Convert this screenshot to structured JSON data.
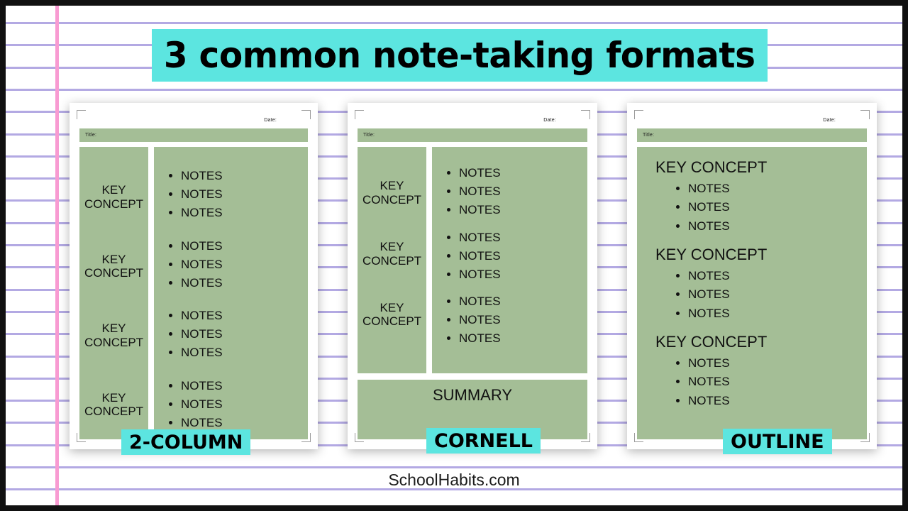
{
  "title": {
    "text": "3 common note-taking formats",
    "highlight_color": "#5ce5e0"
  },
  "footer": {
    "text": "SchoolHabits.com"
  },
  "theme": {
    "green": "#a4be96",
    "cyan": "#5ce5e0",
    "rule_line": "#b3a9e3",
    "margin_line": "#f89bd2",
    "page_border": "#111111"
  },
  "sheet_labels": {
    "date": "Date:",
    "title": "Title:"
  },
  "cards": [
    {
      "id": "2column",
      "badge": "2-COLUMN",
      "date_label": "Date:",
      "title_label": "Title:",
      "key_concepts": [
        "KEY CONCEPT",
        "KEY CONCEPT",
        "KEY CONCEPT",
        "KEY CONCEPT"
      ],
      "note_groups": [
        [
          "NOTES",
          "NOTES",
          "NOTES"
        ],
        [
          "NOTES",
          "NOTES",
          "NOTES"
        ],
        [
          "NOTES",
          "NOTES",
          "NOTES"
        ],
        [
          "NOTES",
          "NOTES",
          "NOTES"
        ]
      ]
    },
    {
      "id": "cornell",
      "badge": "CORNELL",
      "date_label": "Date:",
      "title_label": "Title:",
      "key_concepts": [
        "KEY CONCEPT",
        "KEY CONCEPT",
        "KEY CONCEPT"
      ],
      "note_groups": [
        [
          "NOTES",
          "NOTES",
          "NOTES"
        ],
        [
          "NOTES",
          "NOTES",
          "NOTES"
        ],
        [
          "NOTES",
          "NOTES",
          "NOTES"
        ]
      ],
      "summary_label": "SUMMARY"
    },
    {
      "id": "outline",
      "badge": "OUTLINE",
      "date_label": "Date:",
      "title_label": "Title:",
      "outline_groups": [
        {
          "heading": "KEY CONCEPT",
          "notes": [
            "NOTES",
            "NOTES",
            "NOTES"
          ]
        },
        {
          "heading": "KEY CONCEPT",
          "notes": [
            "NOTES",
            "NOTES",
            "NOTES"
          ]
        },
        {
          "heading": "KEY CONCEPT",
          "notes": [
            "NOTES",
            "NOTES",
            "NOTES"
          ]
        }
      ]
    }
  ]
}
